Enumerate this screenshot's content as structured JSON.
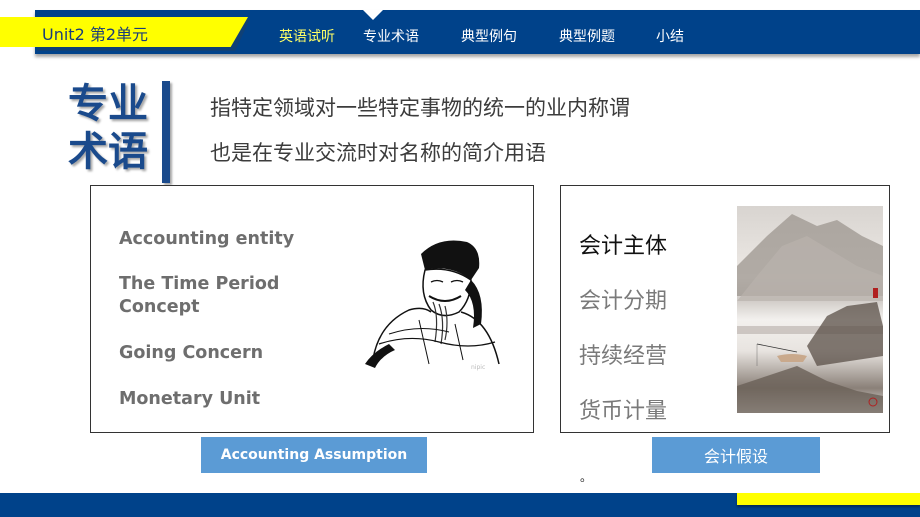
{
  "header": {
    "unit_label": "Unit2 第2单元",
    "nav": [
      {
        "label": "英语试听",
        "active": true
      },
      {
        "label": "专业术语",
        "active": false
      },
      {
        "label": "典型例句",
        "active": false
      },
      {
        "label": "典型例题",
        "active": false
      },
      {
        "label": "小结",
        "active": false
      }
    ],
    "current_section_pointer": "专业术语"
  },
  "title": {
    "line1": "专业",
    "line2": "术语"
  },
  "definition": {
    "line1": "指特定领域对一些特定事物的统一的业内称谓",
    "line2": "也是在专业交流时对名称的简介用语"
  },
  "english_box": {
    "terms": [
      "Accounting entity",
      "The Time Period Concept",
      "Going Concern",
      "Monetary Unit"
    ],
    "image": "ancient-scholar-line-drawing",
    "watermark": "nipic"
  },
  "chinese_box": {
    "terms": [
      "会计主体",
      "会计分期",
      "持续经营",
      "货币计量"
    ],
    "image": "chinese-landscape-ink-painting"
  },
  "captions": {
    "english": "Accounting Assumption",
    "chinese": "会计假设"
  },
  "stray_mark": "。",
  "colors": {
    "navy": "#00428a",
    "yellow": "#ffff00",
    "button_blue": "#5b9bd5",
    "title_blue": "#1a4a8c",
    "active_nav": "#ffff66"
  }
}
